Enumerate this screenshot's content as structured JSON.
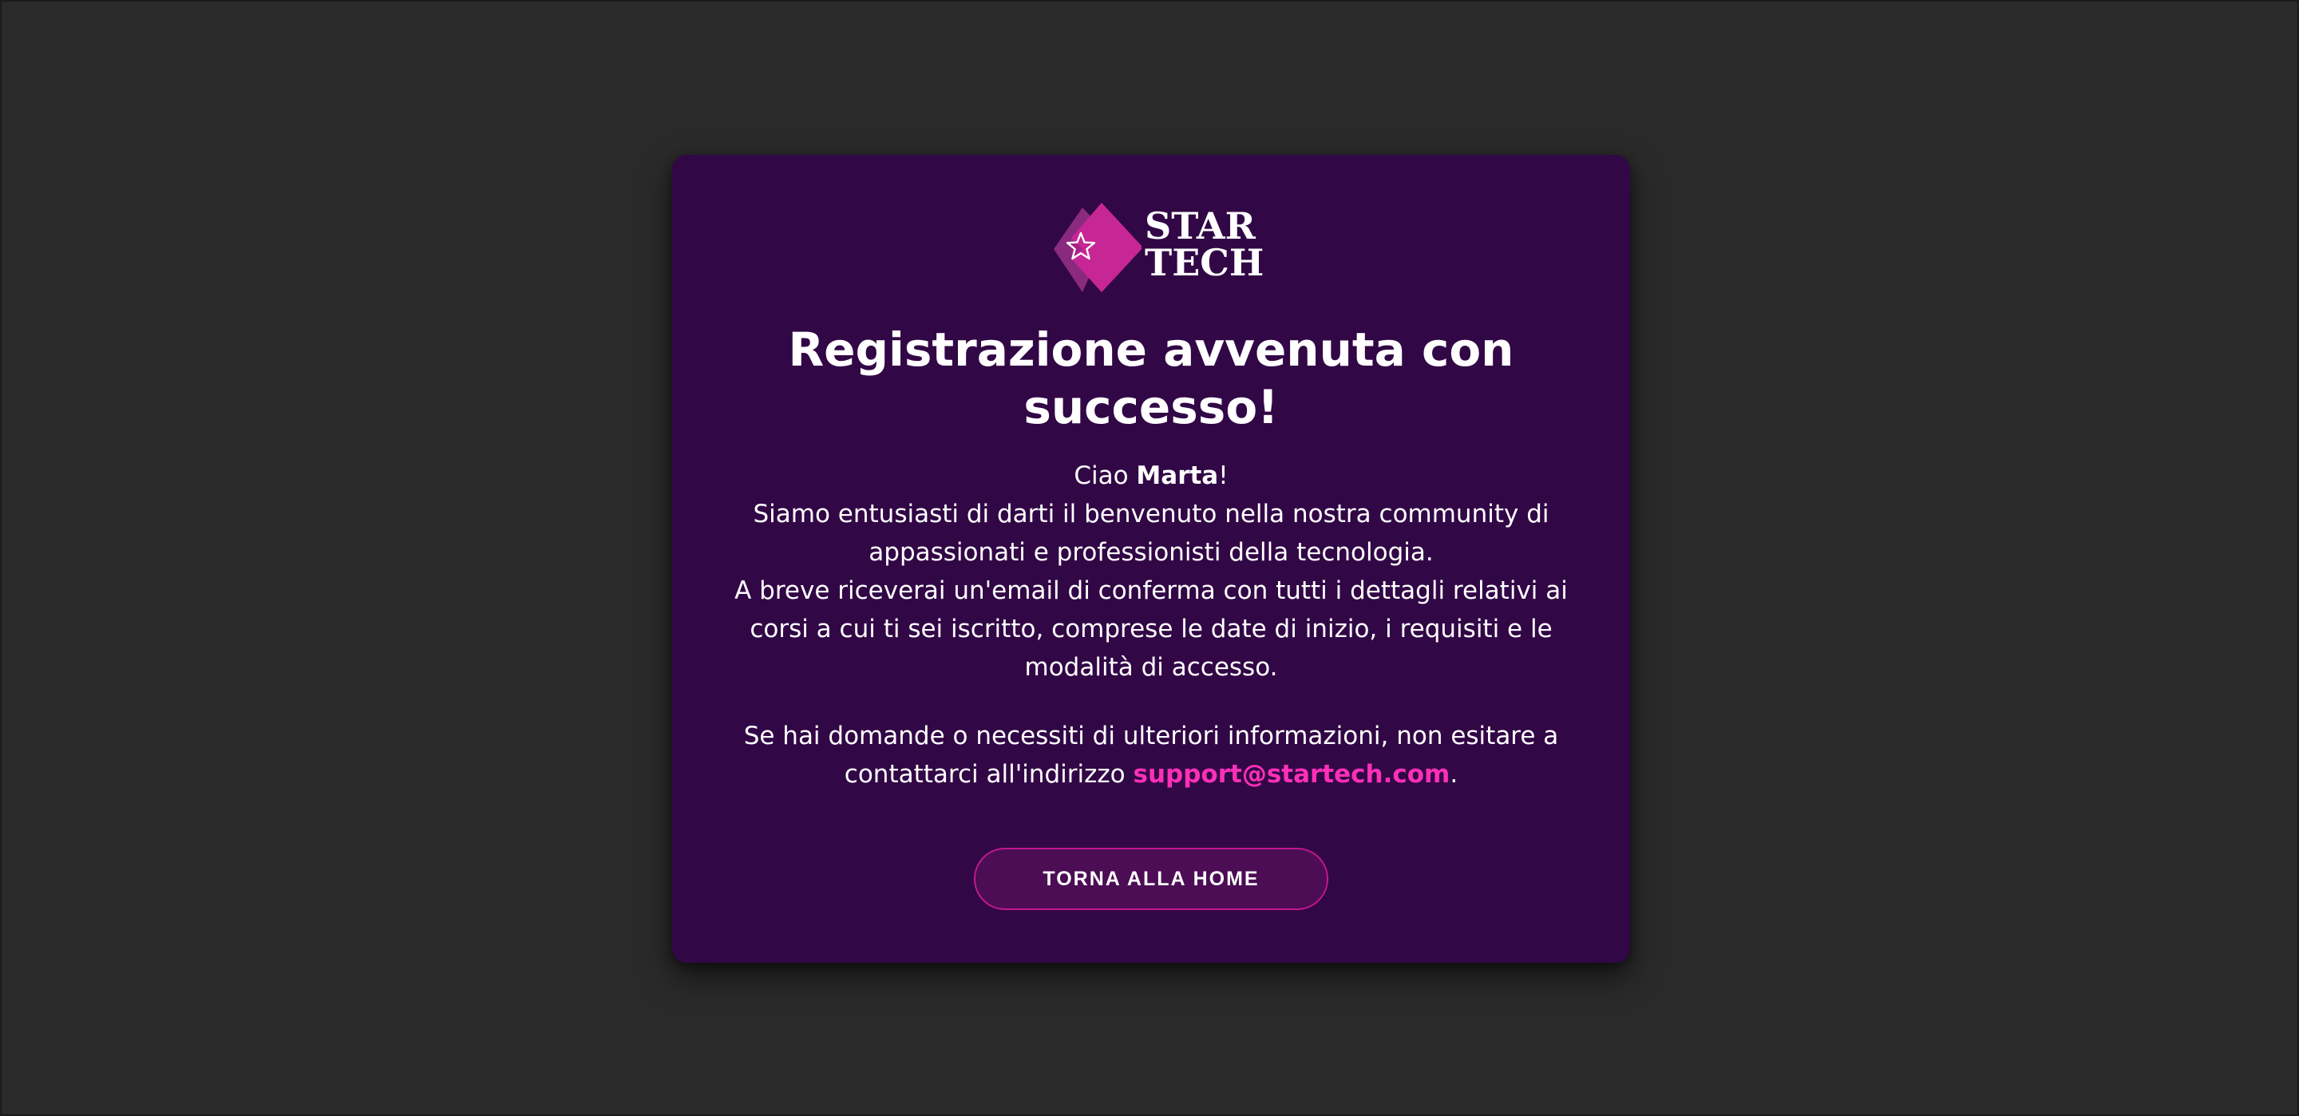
{
  "logo": {
    "line1": "STAR",
    "line2": "TECH",
    "icon": "star-icon",
    "colors": {
      "front": "#c72695",
      "back": "#8a2a7e"
    }
  },
  "title": "Registrazione avvenuta con successo!",
  "message": {
    "greeting_prefix": "Ciao ",
    "name": "Marta",
    "greeting_suffix": "!",
    "welcome": "Siamo entusiasti di darti il benvenuto nella nostra community di appassionati e professionisti della tecnologia.",
    "confirmation": "A breve riceverai un'email di conferma con tutti i dettagli relativi ai corsi a cui ti sei iscritto, comprese le date di inizio, i requisiti e le modalità di accesso.",
    "contact_prefix": "Se hai domande o necessiti di ulteriori informazioni, non esitare a contattarci all'indirizzo ",
    "email": "support@startech.com",
    "contact_suffix": "."
  },
  "button": {
    "label": "TORNA ALLA HOME"
  },
  "colors": {
    "page_background": "#2a2a2a",
    "card_background": "#320746",
    "accent": "#ff2fb8",
    "button_background": "#4c0d55",
    "button_border": "#c2178f"
  }
}
